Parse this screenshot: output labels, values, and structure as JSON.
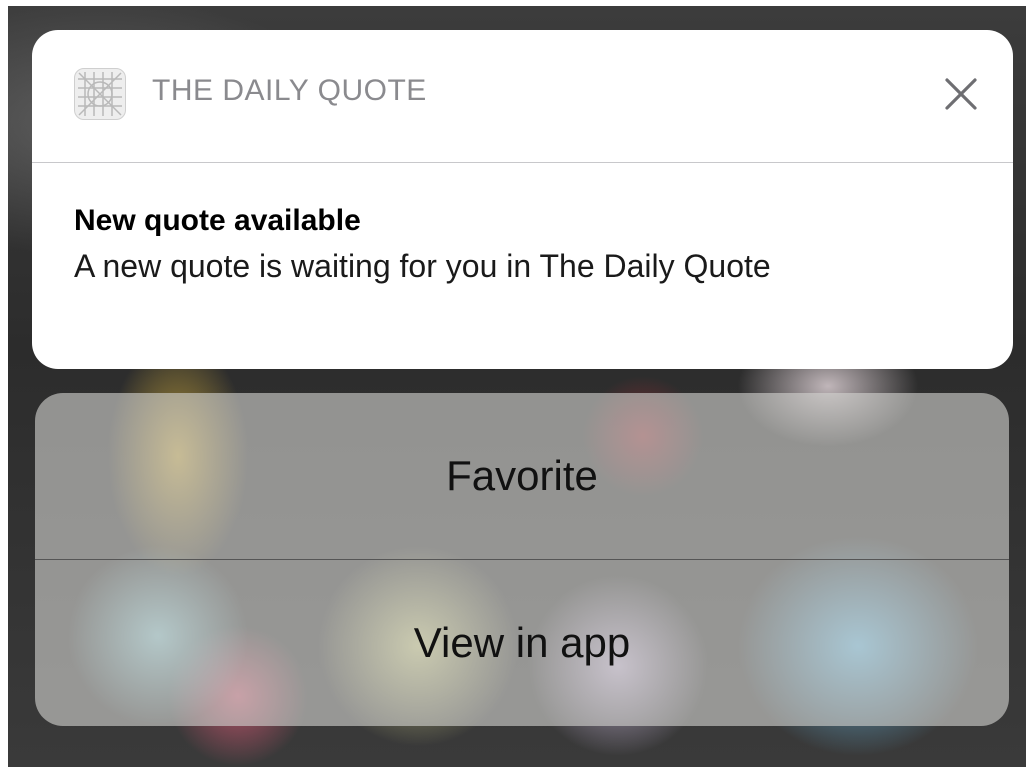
{
  "notification": {
    "app_name": "THE DAILY QUOTE",
    "app_icon": "grid-icon",
    "close_icon": "close-icon",
    "title": "New quote available",
    "text": "A new quote is waiting for you in The Daily Quote"
  },
  "actions": {
    "favorite_label": "Favorite",
    "view_in_app_label": "View in app"
  }
}
